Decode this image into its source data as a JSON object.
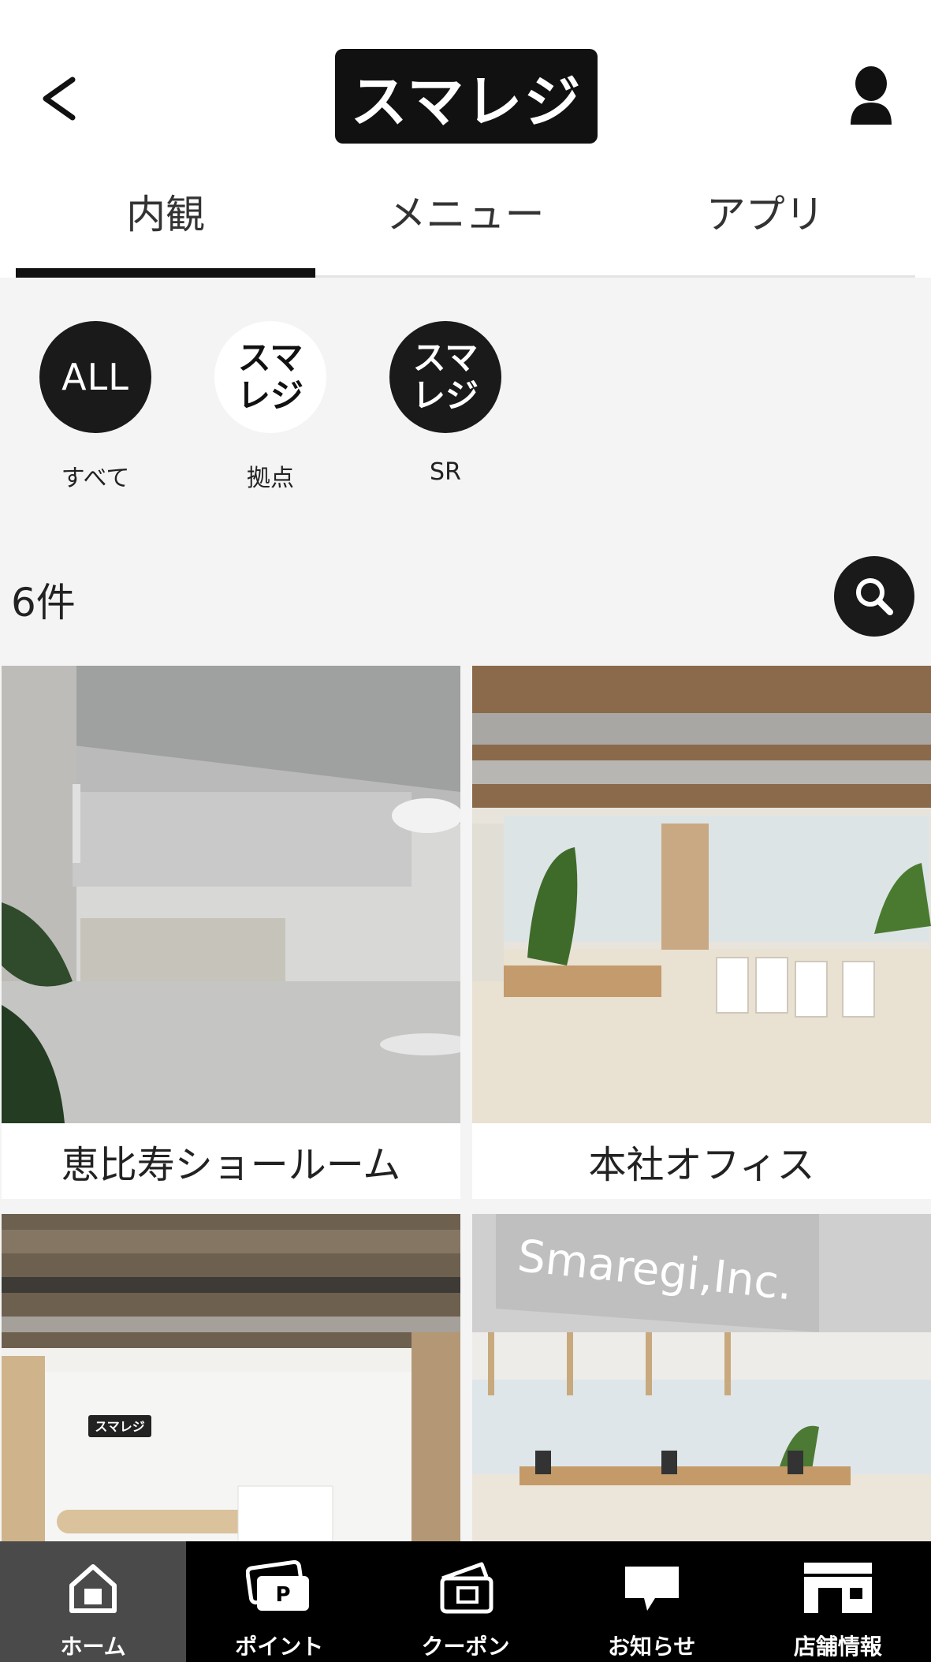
{
  "header": {
    "logo_text": "スマレジ"
  },
  "tabs": [
    {
      "label": "内観",
      "active": true
    },
    {
      "label": "メニュー",
      "active": false
    },
    {
      "label": "アプリ",
      "active": false
    }
  ],
  "categories": [
    {
      "mark": "ALL",
      "label": "すべて"
    },
    {
      "mark": "スマレジ",
      "label": "拠点"
    },
    {
      "mark": "スマレジ",
      "label": "SR"
    }
  ],
  "results": {
    "count_text": "6件"
  },
  "cards": [
    {
      "caption": "恵比寿ショールーム"
    },
    {
      "caption": "本社オフィス"
    },
    {
      "caption": "",
      "sign_text": "スマレジ"
    },
    {
      "caption": "",
      "sign_text": "Smaregi,Inc."
    }
  ],
  "bottom_nav": [
    {
      "label": "ホーム",
      "icon": "home-icon",
      "active": true
    },
    {
      "label": "ポイント",
      "icon": "point-card-icon",
      "active": false
    },
    {
      "label": "クーポン",
      "icon": "coupon-icon",
      "active": false
    },
    {
      "label": "お知らせ",
      "icon": "message-icon",
      "active": false
    },
    {
      "label": "店舗情報",
      "icon": "store-icon",
      "active": false
    }
  ],
  "colors": {
    "primary": "#111111",
    "background_gray": "#f4f4f4",
    "nav_active": "#4a4a4a"
  }
}
